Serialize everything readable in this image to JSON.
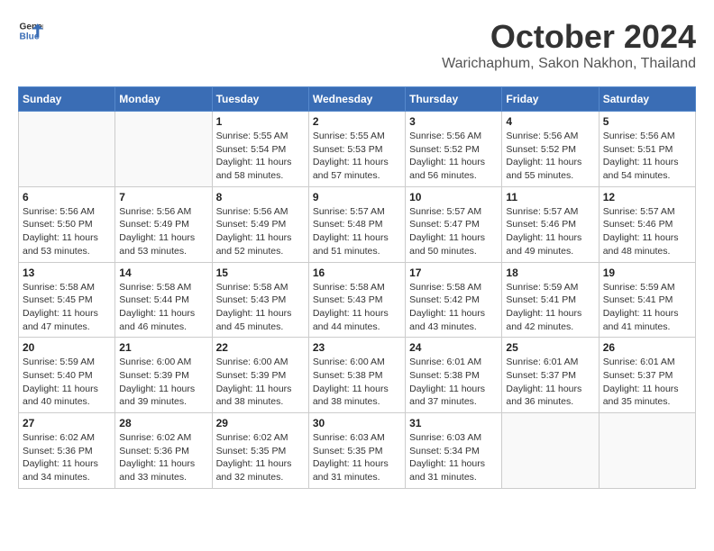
{
  "header": {
    "logo_line1": "General",
    "logo_line2": "Blue",
    "title": "October 2024",
    "subtitle": "Warichaphum, Sakon Nakhon, Thailand"
  },
  "weekdays": [
    "Sunday",
    "Monday",
    "Tuesday",
    "Wednesday",
    "Thursday",
    "Friday",
    "Saturday"
  ],
  "weeks": [
    [
      {
        "day": "",
        "detail": ""
      },
      {
        "day": "",
        "detail": ""
      },
      {
        "day": "1",
        "detail": "Sunrise: 5:55 AM\nSunset: 5:54 PM\nDaylight: 11 hours and 58 minutes."
      },
      {
        "day": "2",
        "detail": "Sunrise: 5:55 AM\nSunset: 5:53 PM\nDaylight: 11 hours and 57 minutes."
      },
      {
        "day": "3",
        "detail": "Sunrise: 5:56 AM\nSunset: 5:52 PM\nDaylight: 11 hours and 56 minutes."
      },
      {
        "day": "4",
        "detail": "Sunrise: 5:56 AM\nSunset: 5:52 PM\nDaylight: 11 hours and 55 minutes."
      },
      {
        "day": "5",
        "detail": "Sunrise: 5:56 AM\nSunset: 5:51 PM\nDaylight: 11 hours and 54 minutes."
      }
    ],
    [
      {
        "day": "6",
        "detail": "Sunrise: 5:56 AM\nSunset: 5:50 PM\nDaylight: 11 hours and 53 minutes."
      },
      {
        "day": "7",
        "detail": "Sunrise: 5:56 AM\nSunset: 5:49 PM\nDaylight: 11 hours and 53 minutes."
      },
      {
        "day": "8",
        "detail": "Sunrise: 5:56 AM\nSunset: 5:49 PM\nDaylight: 11 hours and 52 minutes."
      },
      {
        "day": "9",
        "detail": "Sunrise: 5:57 AM\nSunset: 5:48 PM\nDaylight: 11 hours and 51 minutes."
      },
      {
        "day": "10",
        "detail": "Sunrise: 5:57 AM\nSunset: 5:47 PM\nDaylight: 11 hours and 50 minutes."
      },
      {
        "day": "11",
        "detail": "Sunrise: 5:57 AM\nSunset: 5:46 PM\nDaylight: 11 hours and 49 minutes."
      },
      {
        "day": "12",
        "detail": "Sunrise: 5:57 AM\nSunset: 5:46 PM\nDaylight: 11 hours and 48 minutes."
      }
    ],
    [
      {
        "day": "13",
        "detail": "Sunrise: 5:58 AM\nSunset: 5:45 PM\nDaylight: 11 hours and 47 minutes."
      },
      {
        "day": "14",
        "detail": "Sunrise: 5:58 AM\nSunset: 5:44 PM\nDaylight: 11 hours and 46 minutes."
      },
      {
        "day": "15",
        "detail": "Sunrise: 5:58 AM\nSunset: 5:43 PM\nDaylight: 11 hours and 45 minutes."
      },
      {
        "day": "16",
        "detail": "Sunrise: 5:58 AM\nSunset: 5:43 PM\nDaylight: 11 hours and 44 minutes."
      },
      {
        "day": "17",
        "detail": "Sunrise: 5:58 AM\nSunset: 5:42 PM\nDaylight: 11 hours and 43 minutes."
      },
      {
        "day": "18",
        "detail": "Sunrise: 5:59 AM\nSunset: 5:41 PM\nDaylight: 11 hours and 42 minutes."
      },
      {
        "day": "19",
        "detail": "Sunrise: 5:59 AM\nSunset: 5:41 PM\nDaylight: 11 hours and 41 minutes."
      }
    ],
    [
      {
        "day": "20",
        "detail": "Sunrise: 5:59 AM\nSunset: 5:40 PM\nDaylight: 11 hours and 40 minutes."
      },
      {
        "day": "21",
        "detail": "Sunrise: 6:00 AM\nSunset: 5:39 PM\nDaylight: 11 hours and 39 minutes."
      },
      {
        "day": "22",
        "detail": "Sunrise: 6:00 AM\nSunset: 5:39 PM\nDaylight: 11 hours and 38 minutes."
      },
      {
        "day": "23",
        "detail": "Sunrise: 6:00 AM\nSunset: 5:38 PM\nDaylight: 11 hours and 38 minutes."
      },
      {
        "day": "24",
        "detail": "Sunrise: 6:01 AM\nSunset: 5:38 PM\nDaylight: 11 hours and 37 minutes."
      },
      {
        "day": "25",
        "detail": "Sunrise: 6:01 AM\nSunset: 5:37 PM\nDaylight: 11 hours and 36 minutes."
      },
      {
        "day": "26",
        "detail": "Sunrise: 6:01 AM\nSunset: 5:37 PM\nDaylight: 11 hours and 35 minutes."
      }
    ],
    [
      {
        "day": "27",
        "detail": "Sunrise: 6:02 AM\nSunset: 5:36 PM\nDaylight: 11 hours and 34 minutes."
      },
      {
        "day": "28",
        "detail": "Sunrise: 6:02 AM\nSunset: 5:36 PM\nDaylight: 11 hours and 33 minutes."
      },
      {
        "day": "29",
        "detail": "Sunrise: 6:02 AM\nSunset: 5:35 PM\nDaylight: 11 hours and 32 minutes."
      },
      {
        "day": "30",
        "detail": "Sunrise: 6:03 AM\nSunset: 5:35 PM\nDaylight: 11 hours and 31 minutes."
      },
      {
        "day": "31",
        "detail": "Sunrise: 6:03 AM\nSunset: 5:34 PM\nDaylight: 11 hours and 31 minutes."
      },
      {
        "day": "",
        "detail": ""
      },
      {
        "day": "",
        "detail": ""
      }
    ]
  ]
}
